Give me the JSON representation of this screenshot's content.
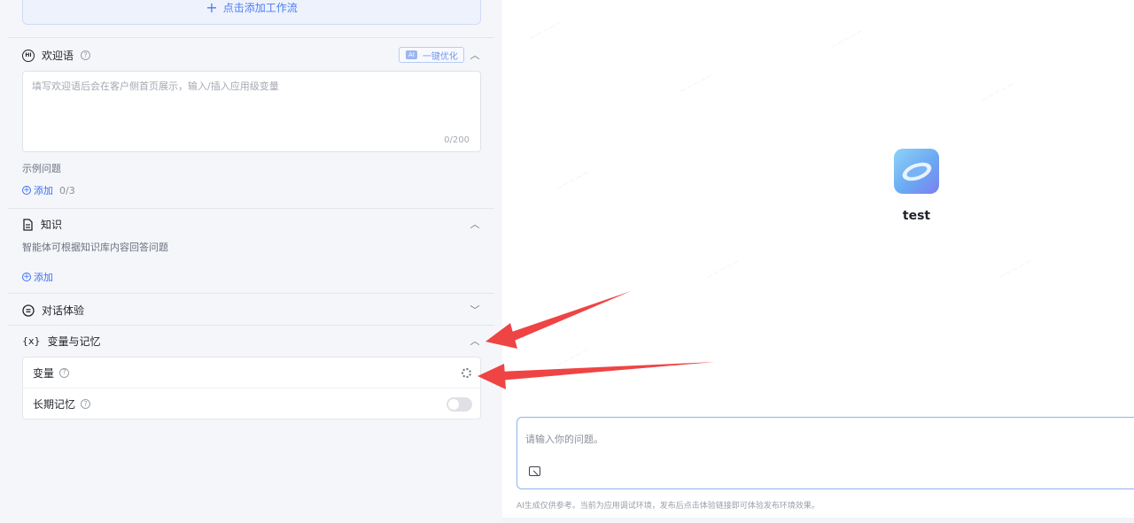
{
  "workflow": {
    "add_label": "点击添加工作流"
  },
  "welcome": {
    "title": "欢迎语",
    "optimize_tag": "AI",
    "optimize_label": "一键优化",
    "placeholder": "填写欢迎语后会在客户侧首页展示，输入/插入应用级变量",
    "counter": "0/200"
  },
  "examples": {
    "label": "示例问题",
    "add_label": "添加",
    "count": "0/3"
  },
  "knowledge": {
    "title": "知识",
    "desc": "智能体可根据知识库内容回答问题",
    "add_label": "添加"
  },
  "dialog": {
    "title": "对话体验"
  },
  "variables": {
    "title": "变量与记忆",
    "icon_text": "{x}",
    "rows": [
      {
        "label": "变量"
      },
      {
        "label": "长期记忆",
        "enabled": false
      }
    ]
  },
  "preview": {
    "bot_name": "test",
    "input_placeholder": "请输入你的问题。",
    "disclaimer": "AI生成仅供参考。当前为应用调试环境，发布后点击体验链接即可体验发布环境效果。"
  },
  "icons": {
    "welcome": "welcome-badge-icon",
    "knowledge": "document-icon",
    "dialog": "dialog-icon",
    "variables": "variable-braces-icon",
    "gear": "gear-icon",
    "image": "image-upload-icon"
  },
  "colors": {
    "accent": "#3b6ff5",
    "annotation_arrow": "#ef4444"
  }
}
